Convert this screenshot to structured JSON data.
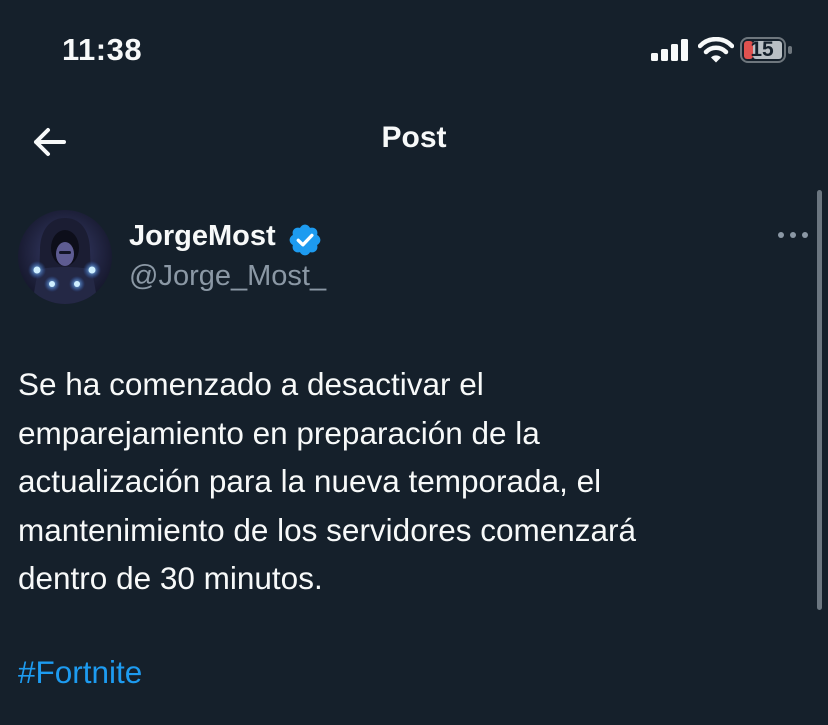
{
  "status_bar": {
    "time": "11:38",
    "battery": "15",
    "icons": [
      "signal-icon",
      "wifi-icon",
      "battery-icon"
    ],
    "battery_color": "#e0524f"
  },
  "header": {
    "back_icon": "arrow-left-icon",
    "title": "Post"
  },
  "post": {
    "author": {
      "name": "JorgeMost",
      "handle": "@Jorge_Most_",
      "verified": true,
      "verified_color": "#1d9bf0"
    },
    "more_icon": "more-horizontal-icon",
    "text_lines": [
      "Se ha comenzado a desactivar el",
      "emparejamiento en preparación de la",
      "actualización para la nueva temporada, el",
      "mantenimiento de los servidores comenzará",
      "dentro de 30 minutos."
    ],
    "hashtag": "#Fortnite",
    "hashtag_color": "#1d9bf0"
  },
  "colors": {
    "background": "#15202b",
    "text": "#f7f9f9",
    "secondary_text": "#8b98a5"
  }
}
